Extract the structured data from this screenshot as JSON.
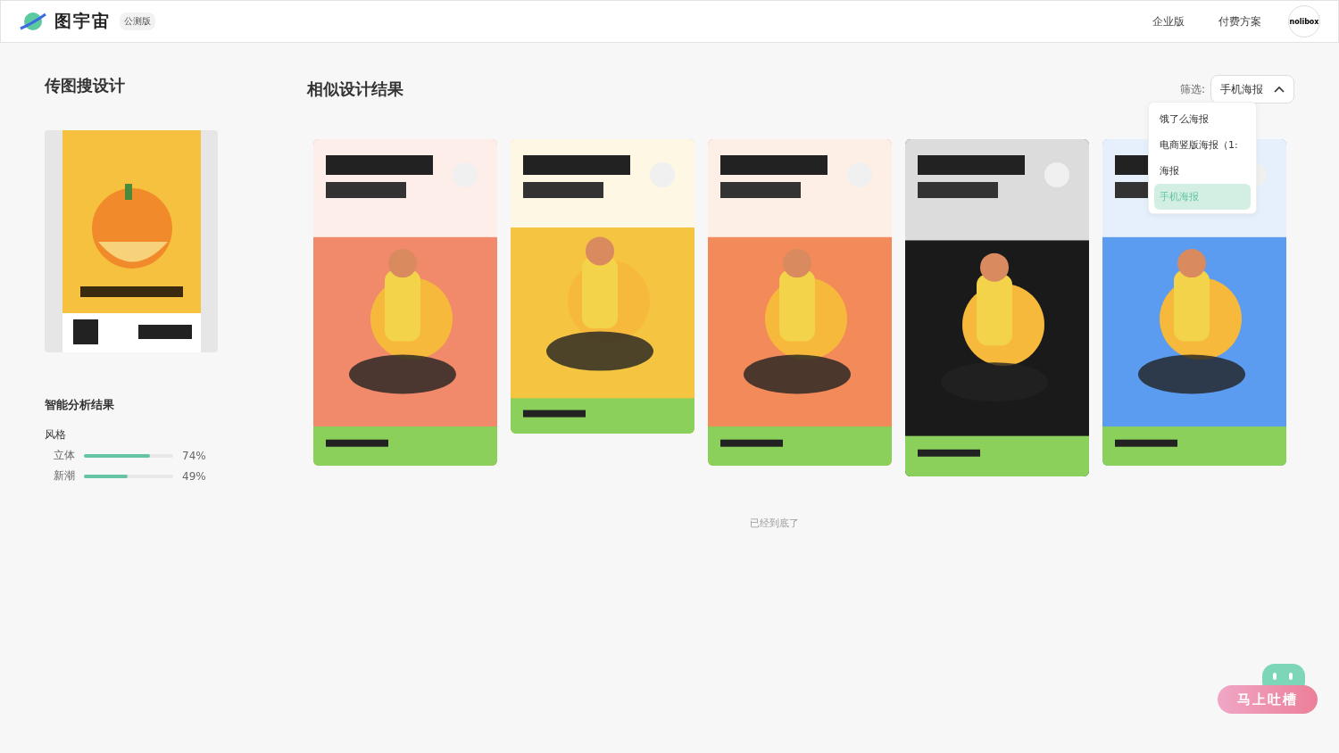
{
  "header": {
    "brand": "图宇宙",
    "badge": "公测版",
    "nav": [
      "企业版",
      "付费方案"
    ],
    "avatar": "nolibox"
  },
  "upload": {
    "title": "传图搜设计"
  },
  "analysis": {
    "title": "智能分析结果",
    "group": "风格",
    "metrics": [
      {
        "name": "立体",
        "level": 0.74,
        "reading": "74%"
      },
      {
        "name": "新潮",
        "level": 0.49,
        "reading": "49%"
      }
    ]
  },
  "results": {
    "title": "相似设计结果",
    "filter_label": "筛选:",
    "filter_value": "手机海报",
    "filter_open": true,
    "options": [
      {
        "label": "饿了么海报",
        "selected": false
      },
      {
        "label": "电商竖版海报（1:",
        "selected": false
      },
      {
        "label": "海报",
        "selected": false
      },
      {
        "label": "手机海报",
        "selected": true
      }
    ],
    "end_note": "已经到底了"
  },
  "feedback": {
    "label": "马上吐槽"
  }
}
